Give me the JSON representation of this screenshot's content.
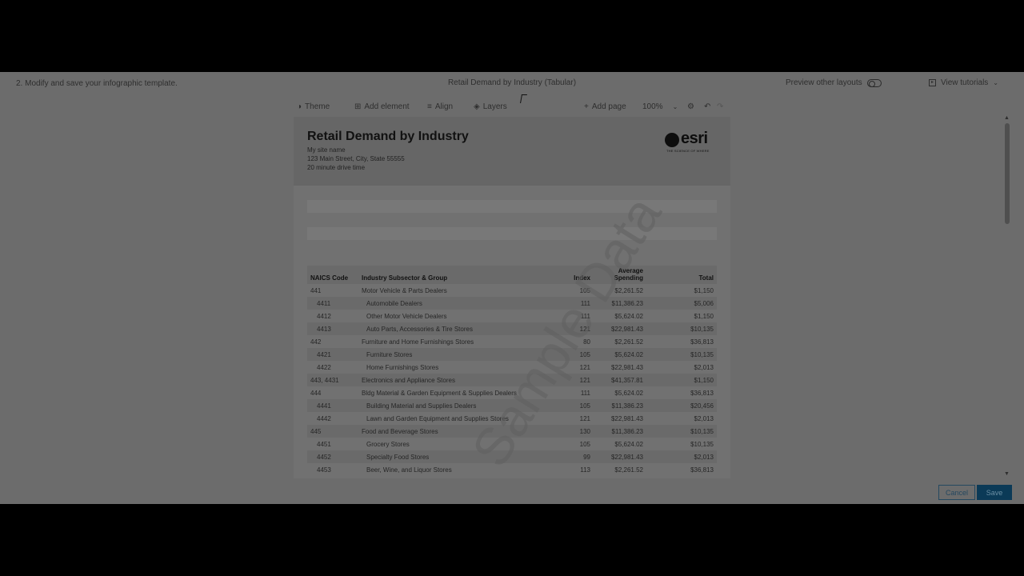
{
  "header": {
    "step": "2.  Modify and save your infographic template.",
    "doc_title": "Retail Demand by Industry (Tabular)",
    "preview_label": "Preview other layouts",
    "tutorials_label": "View tutorials"
  },
  "toolbar": {
    "theme": "Theme",
    "add_element": "Add element",
    "align": "Align",
    "layers": "Layers",
    "add_page": "Add page",
    "zoom": "100%"
  },
  "report": {
    "title": "Retail Demand by Industry",
    "site_name": "My site name",
    "address": "123 Main Street, City, State 55555",
    "drive_time": "20 minute drive time",
    "logo_text": "esri",
    "logo_tagline": "THE SCIENCE OF WHERE",
    "watermark": "Sample Data"
  },
  "table": {
    "headers": [
      "NAICS Code",
      "Industry Subsector & Group",
      "Index",
      "Average Spending",
      "Total"
    ],
    "rows": [
      {
        "code": "441",
        "name": "Motor Vehicle & Parts Dealers",
        "index": "105",
        "avg": "$2,261.52",
        "total": "$1,150",
        "sub": false
      },
      {
        "code": "4411",
        "name": "Automobile Dealers",
        "index": "111",
        "avg": "$11,386.23",
        "total": "$5,006",
        "sub": true
      },
      {
        "code": "4412",
        "name": "Other Motor Vehicle Dealers",
        "index": "111",
        "avg": "$5,624.02",
        "total": "$1,150",
        "sub": true
      },
      {
        "code": "4413",
        "name": "Auto Parts, Accessories & Tire Stores",
        "index": "121",
        "avg": "$22,981.43",
        "total": "$10,135",
        "sub": true
      },
      {
        "code": "442",
        "name": "Furniture and Home Furnishings Stores",
        "index": "80",
        "avg": "$2,261.52",
        "total": "$36,813",
        "sub": false
      },
      {
        "code": "4421",
        "name": "Furniture Stores",
        "index": "105",
        "avg": "$5,624.02",
        "total": "$10,135",
        "sub": true
      },
      {
        "code": "4422",
        "name": "Home Furnishings Stores",
        "index": "121",
        "avg": "$22,981.43",
        "total": "$2,013",
        "sub": true
      },
      {
        "code": "443, 4431",
        "name": "Electronics and Appliance Stores",
        "index": "121",
        "avg": "$41,357.81",
        "total": "$1,150",
        "sub": false
      },
      {
        "code": "444",
        "name": "Bldg Material & Garden Equipment & Supplies Dealers",
        "index": "111",
        "avg": "$5,624.02",
        "total": "$36,813",
        "sub": false
      },
      {
        "code": "4441",
        "name": "Building Material and Supplies Dealers",
        "index": "105",
        "avg": "$11,386.23",
        "total": "$20,456",
        "sub": true
      },
      {
        "code": "4442",
        "name": "Lawn and Garden Equipment and Supplies Stores",
        "index": "121",
        "avg": "$22,981.43",
        "total": "$2,013",
        "sub": true
      },
      {
        "code": "445",
        "name": "Food and Beverage Stores",
        "index": "130",
        "avg": "$11,386.23",
        "total": "$10,135",
        "sub": false
      },
      {
        "code": "4451",
        "name": "Grocery Stores",
        "index": "105",
        "avg": "$5,624.02",
        "total": "$10,135",
        "sub": true
      },
      {
        "code": "4452",
        "name": "Specialty Food Stores",
        "index": "99",
        "avg": "$22,981.43",
        "total": "$2,013",
        "sub": true
      },
      {
        "code": "4453",
        "name": "Beer, Wine, and Liquor Stores",
        "index": "113",
        "avg": "$2,261.52",
        "total": "$36,813",
        "sub": true
      }
    ]
  },
  "footer": {
    "cancel": "Cancel",
    "save": "Save"
  }
}
